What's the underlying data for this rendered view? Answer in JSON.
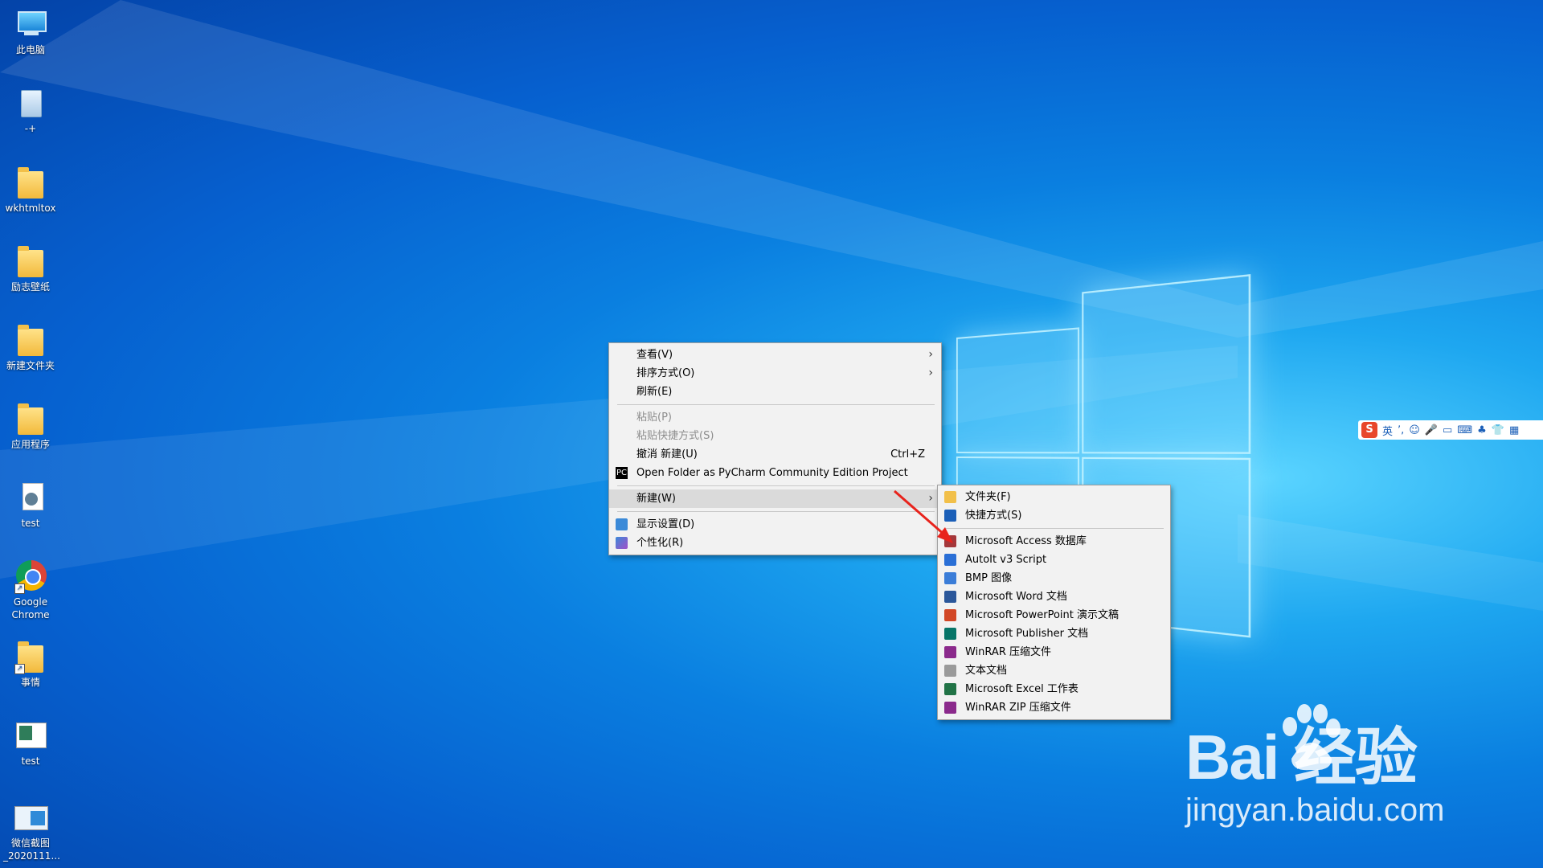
{
  "desktop_icons": [
    {
      "id": "pc",
      "label": "此电脑",
      "icon": "computer-icon"
    },
    {
      "id": "recycle",
      "label": "-+",
      "icon": "recycle-bin-icon"
    },
    {
      "id": "wkhtmltox",
      "label": "wkhtmltox",
      "icon": "folder-icon"
    },
    {
      "id": "lizhi",
      "label": "励志壁纸",
      "icon": "folder-icon"
    },
    {
      "id": "newfolder",
      "label": "新建文件夹",
      "icon": "folder-icon"
    },
    {
      "id": "apps",
      "label": "应用程序",
      "icon": "folder-icon"
    },
    {
      "id": "test1",
      "label": "test",
      "icon": "document-icon"
    },
    {
      "id": "chrome",
      "label": "Google Chrome",
      "icon": "chrome-icon"
    },
    {
      "id": "shiqing",
      "label": "事情",
      "icon": "folder-shortcut-icon"
    },
    {
      "id": "test2",
      "label": "test",
      "icon": "image-icon"
    },
    {
      "id": "wechat",
      "label": "微信截图_2020111...",
      "icon": "image-icon"
    }
  ],
  "context_menu": {
    "view": "查看(V)",
    "sort": "排序方式(O)",
    "refresh": "刷新(E)",
    "paste": "粘贴(P)",
    "paste_shortcut": "粘贴快捷方式(S)",
    "undo": "撤消 新建(U)",
    "undo_shortcut": "Ctrl+Z",
    "pycharm": "Open Folder as PyCharm Community Edition Project",
    "pycharm_icon_text": "PC",
    "new": "新建(W)",
    "display": "显示设置(D)",
    "personalize": "个性化(R)"
  },
  "new_submenu": {
    "items": [
      {
        "label": "文件夹(F)",
        "icon": "folder-icon",
        "color": "#f2c04a"
      },
      {
        "label": "快捷方式(S)",
        "icon": "shortcut-icon",
        "color": "#1b5fb8"
      },
      {
        "label": "Microsoft Access 数据库",
        "icon": "access-icon",
        "color": "#a4373a"
      },
      {
        "label": "AutoIt v3 Script",
        "icon": "autoit-icon",
        "color": "#2a6fd6"
      },
      {
        "label": "BMP 图像",
        "icon": "bmp-icon",
        "color": "#3b7dd8"
      },
      {
        "label": "Microsoft Word 文档",
        "icon": "word-icon",
        "color": "#2b579a"
      },
      {
        "label": "Microsoft PowerPoint 演示文稿",
        "icon": "powerpoint-icon",
        "color": "#d24726"
      },
      {
        "label": "Microsoft Publisher 文档",
        "icon": "publisher-icon",
        "color": "#077568"
      },
      {
        "label": "WinRAR 压缩文件",
        "icon": "winrar-icon",
        "color": "#8b2a8c"
      },
      {
        "label": "文本文档",
        "icon": "text-icon",
        "color": "#9a9a9a"
      },
      {
        "label": "Microsoft Excel 工作表",
        "icon": "excel-icon",
        "color": "#217346"
      },
      {
        "label": "WinRAR ZIP 压缩文件",
        "icon": "winrar-zip-icon",
        "color": "#8b2a8c"
      }
    ]
  },
  "ime_bar": {
    "logo": "S",
    "lang": "英",
    "items": [
      "ʼ,",
      "☺",
      "🎤",
      "▭",
      "⌨",
      "♣",
      "👕",
      "▦"
    ]
  },
  "watermark": {
    "brand": "Bai  经验",
    "url": "jingyan.baidu.com"
  }
}
